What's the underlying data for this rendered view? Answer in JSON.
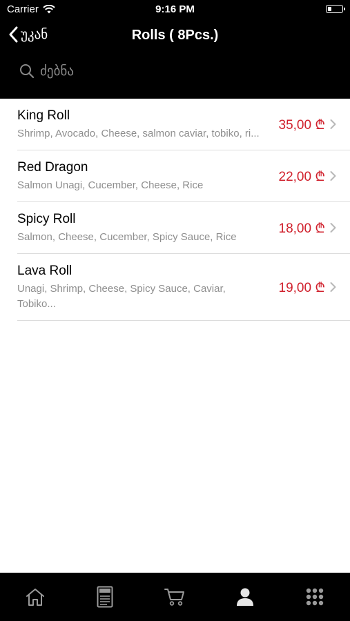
{
  "status_bar": {
    "carrier": "Carrier",
    "time": "9:16 PM"
  },
  "nav": {
    "back_label": "უკან",
    "title": "Rolls ( 8Pcs.)"
  },
  "search": {
    "placeholder": "ძებნა"
  },
  "items": [
    {
      "name": "King Roll",
      "description": "Shrimp, Avocado, Cheese, salmon caviar, tobiko, ri...",
      "price": "35,00 ₾"
    },
    {
      "name": "Red Dragon",
      "description": "Salmon Unagi, Cucember, Cheese, Rice",
      "price": "22,00 ₾"
    },
    {
      "name": "Spicy Roll",
      "description": "Salmon, Cheese, Cucember, Spicy Sauce, Rice",
      "price": "18,00 ₾"
    },
    {
      "name": "Lava Roll",
      "description": "Unagi, Shrimp, Cheese, Spicy Sauce, Caviar, Tobiko...",
      "price": "19,00 ₾"
    }
  ],
  "tabbar": {
    "menu_icon_text": "MENU"
  },
  "colors": {
    "header_bg": "#000000",
    "price": "#d0202c",
    "description": "#8e8e8e",
    "separator": "#dcdcdc"
  },
  "icons": {
    "tabs": [
      "home-icon",
      "menu-icon",
      "cart-icon",
      "profile-icon",
      "grid-icon"
    ]
  }
}
